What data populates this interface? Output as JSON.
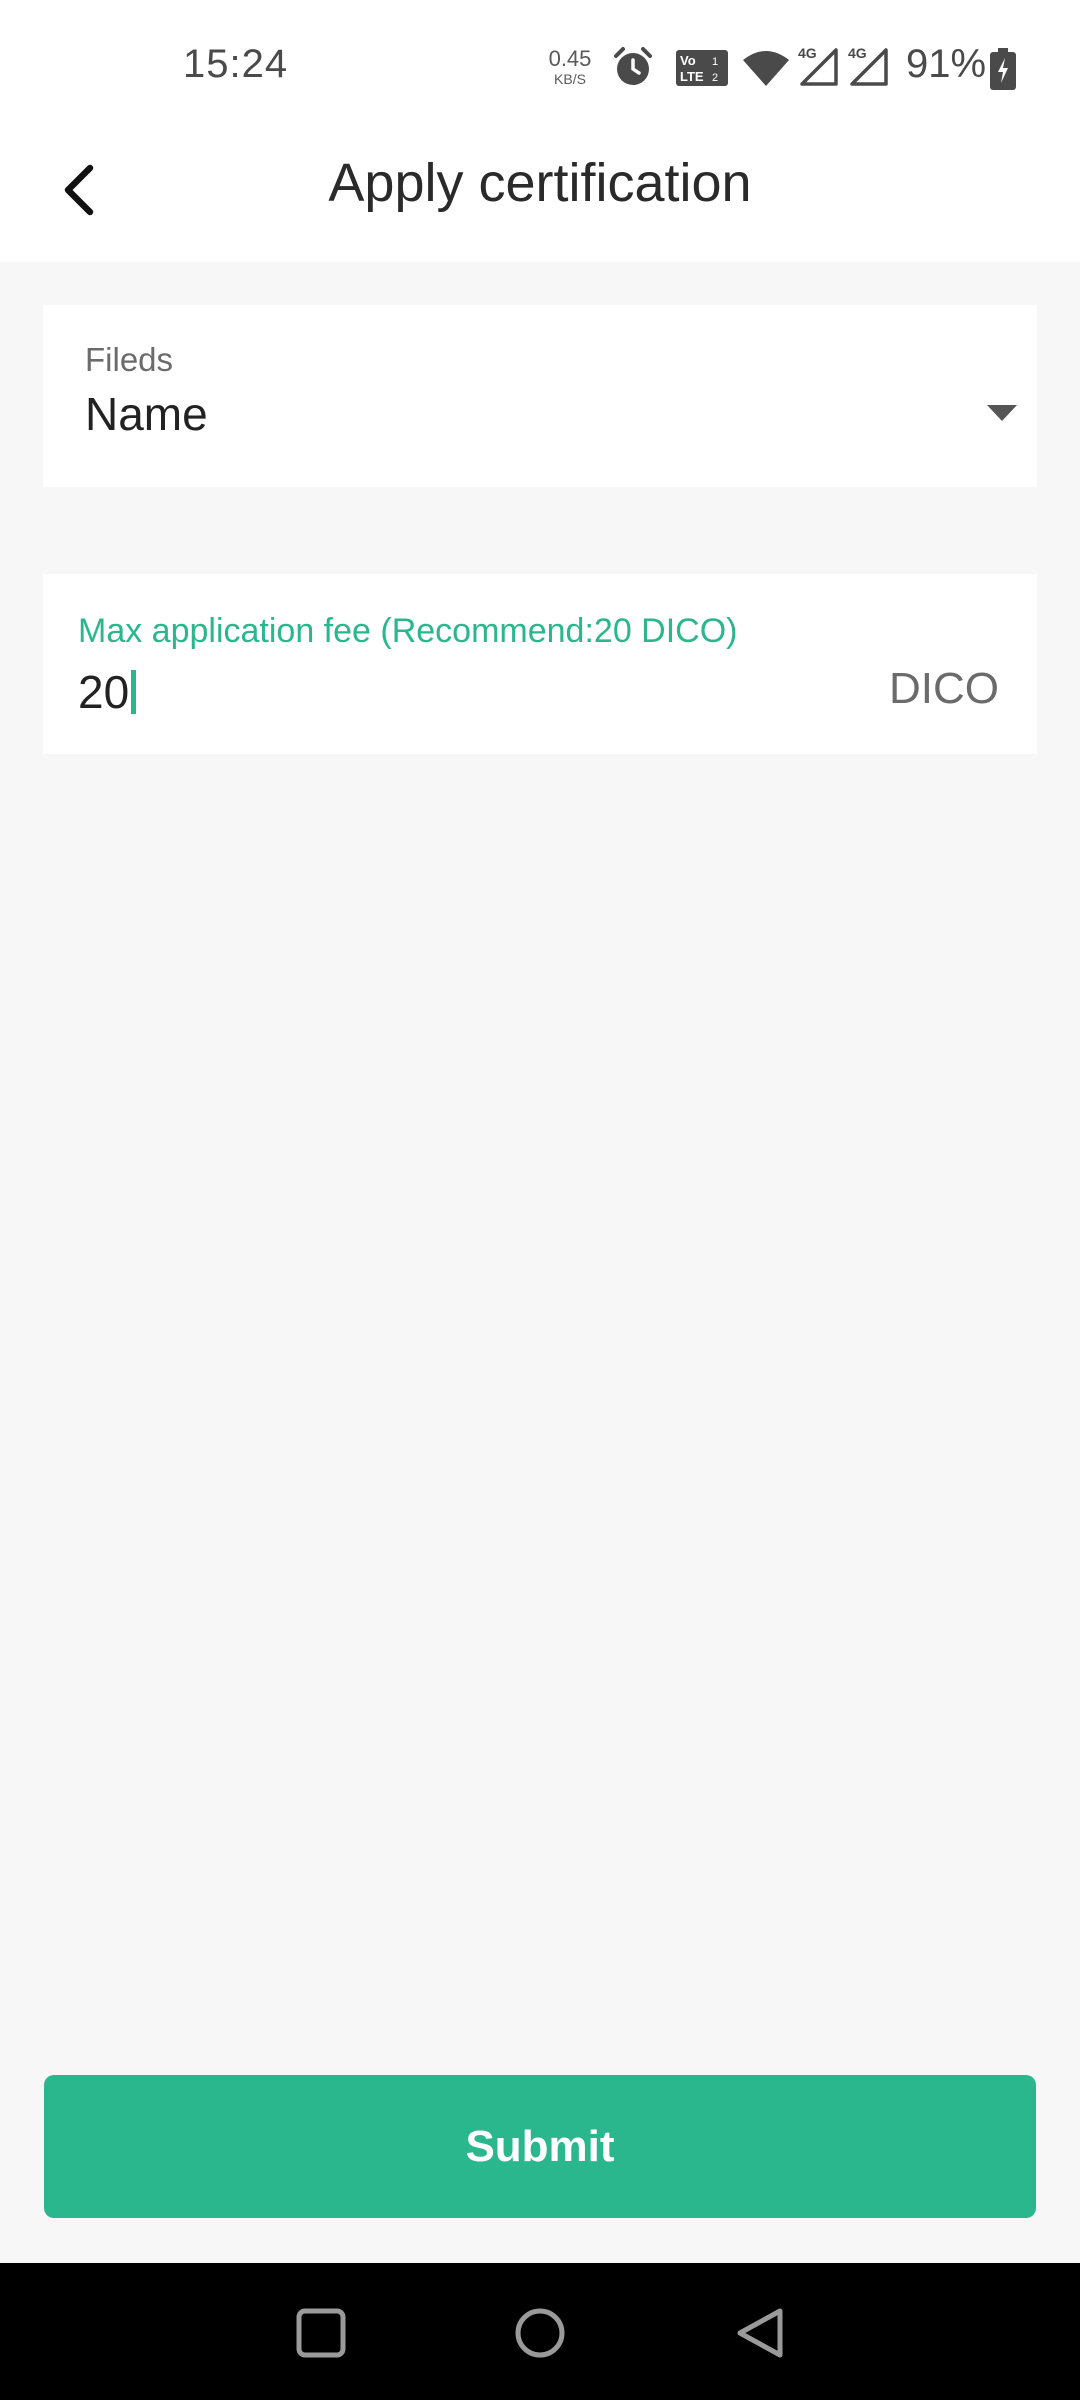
{
  "status_bar": {
    "time": "15:24",
    "net_speed_value": "0.45",
    "net_speed_unit": "KB/S",
    "battery_percent": "91%",
    "icons": [
      "alarm-icon",
      "volte-icon",
      "wifi-icon",
      "signal-4g-icon",
      "signal-4g-icon",
      "battery-charging-icon"
    ]
  },
  "header": {
    "title": "Apply certification",
    "back_icon": "back-arrow-icon"
  },
  "fields_select": {
    "label": "Fileds",
    "value": "Name",
    "icon": "dropdown-arrow-icon"
  },
  "fee_input": {
    "label": "Max application fee (Recommend:20 DICO)",
    "value": "20",
    "unit": "DICO"
  },
  "submit": {
    "label": "Submit"
  },
  "nav_bar": {
    "icons": [
      "recents-icon",
      "home-icon",
      "back-icon"
    ]
  },
  "colors": {
    "accent": "#2bb78d",
    "background": "#f7f7f7",
    "surface": "#ffffff",
    "nav_bar": "#000000"
  }
}
